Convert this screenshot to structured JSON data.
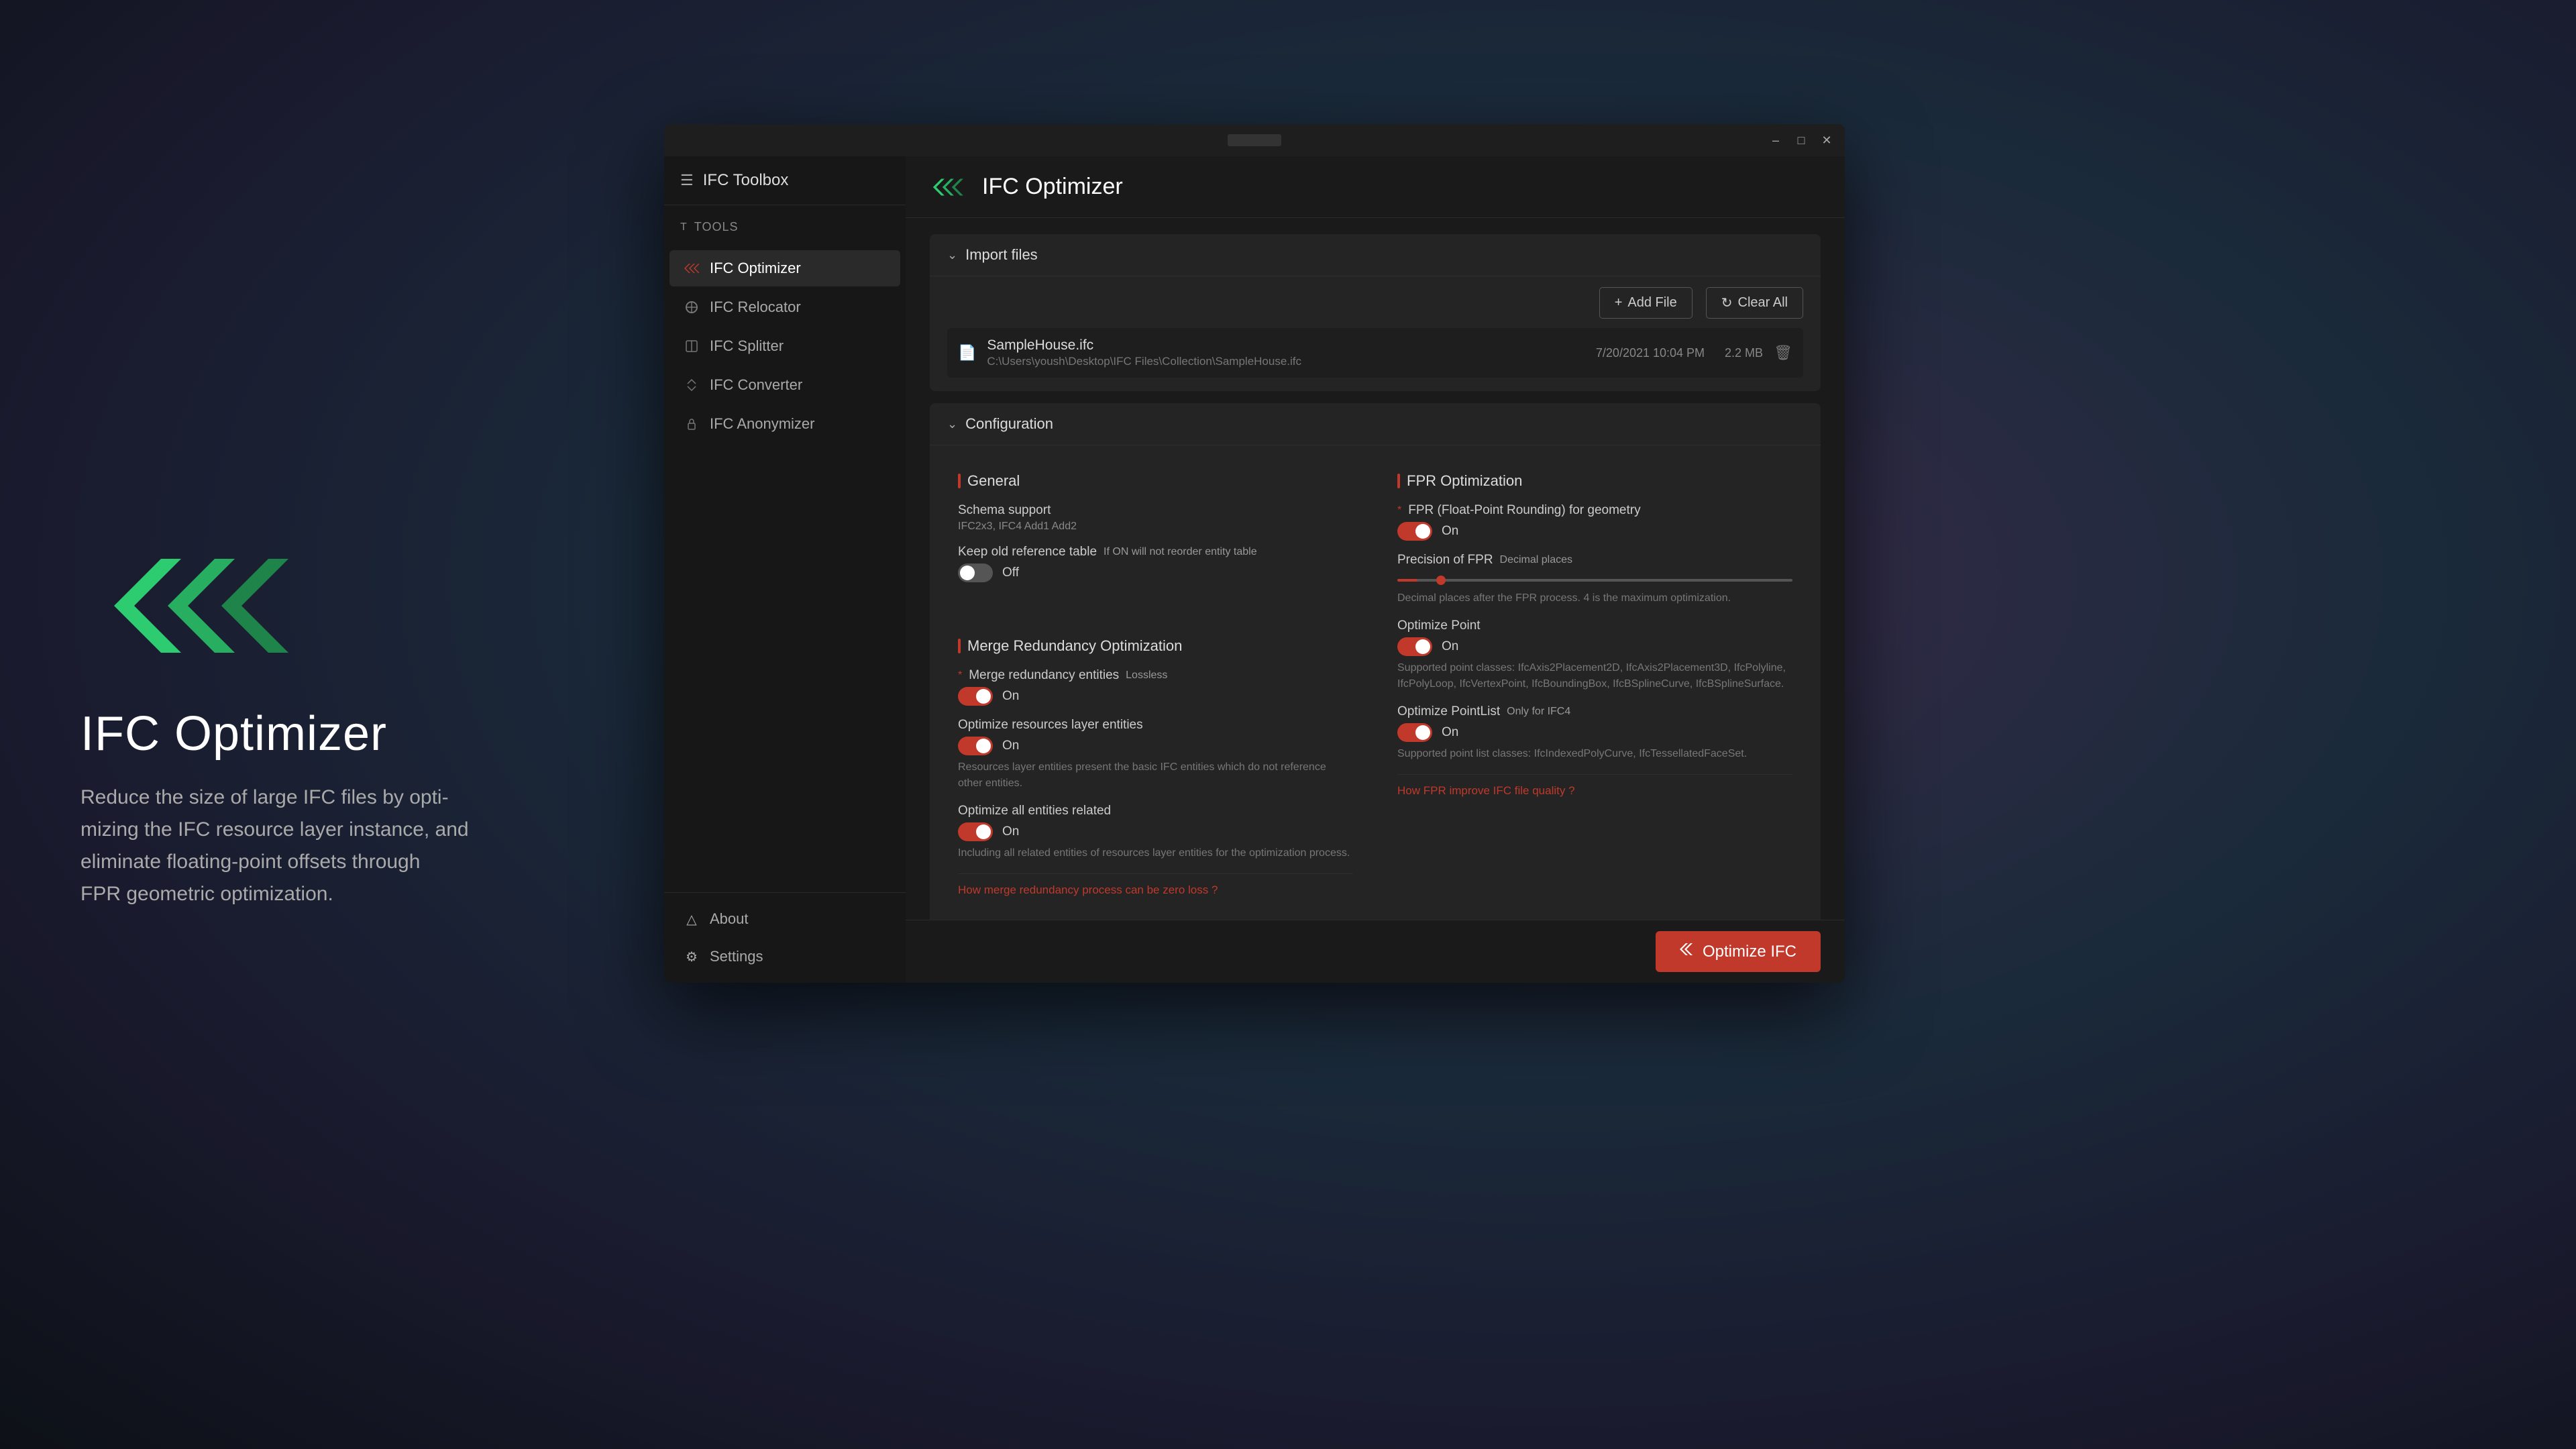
{
  "app": {
    "title": "IFC Optimizer",
    "description": "Reduce the size of large IFC files by opti-\nmizing the IFC resource layer instance, and\neliminate floating-point offsets through\nFPR geometric optimization."
  },
  "window": {
    "title_bar_label": "IFC Optimizer"
  },
  "sidebar": {
    "header": "IFC Toolbox",
    "section_tools": "Tools",
    "items": [
      {
        "id": "ifc-optimizer",
        "label": "IFC Optimizer",
        "active": true
      },
      {
        "id": "ifc-relocator",
        "label": "IFC Relocator",
        "active": false
      },
      {
        "id": "ifc-splitter",
        "label": "IFC Splitter",
        "active": false
      },
      {
        "id": "ifc-converter",
        "label": "IFC Converter",
        "active": false
      },
      {
        "id": "ifc-anonymizer",
        "label": "IFC Anonymizer",
        "active": false
      }
    ],
    "bottom": [
      {
        "id": "about",
        "label": "About"
      },
      {
        "id": "settings",
        "label": "Settings"
      }
    ]
  },
  "main": {
    "header_title": "IFC Optimizer",
    "import_files": {
      "section_title": "Import files",
      "add_file_btn": "Add File",
      "clear_all_btn": "Clear All",
      "file": {
        "name": "SampleHouse.ifc",
        "path": "C:\\Users\\yoush\\Desktop\\IFC Files\\Collection\\SampleHouse.ifc",
        "date": "7/20/2021 10:04 PM",
        "size": "2.2 MB"
      }
    },
    "configuration": {
      "section_title": "Configuration",
      "general": {
        "title": "General",
        "schema_support_label": "Schema support",
        "schema_support_value": "IFC2x3, IFC4 Add1 Add2",
        "keep_old_ref_label": "Keep old reference table",
        "keep_old_ref_hint": "If ON will not reorder entity table",
        "keep_old_ref_state": "off",
        "keep_old_ref_toggle_label": "Off"
      },
      "merge_redundancy": {
        "title": "Merge Redundancy Optimization",
        "merge_entities_label": "Merge redundancy entities",
        "merge_entities_badge": "Lossless",
        "merge_entities_state": "on",
        "merge_entities_toggle_label": "On",
        "optimize_resources_label": "Optimize resources layer entities",
        "optimize_resources_state": "on",
        "optimize_resources_toggle_label": "On",
        "optimize_resources_note": "Resources layer entities present the basic IFC entities which do not\nreference other entities.",
        "optimize_all_label": "Optimize all entities related",
        "optimize_all_state": "on",
        "optimize_all_toggle_label": "On",
        "optimize_all_note": "Including all related entities of resources layer entities for the\noptimization process.",
        "link_text": "How merge redundancy process can be zero loss ?"
      },
      "fpr": {
        "title": "FPR Optimization",
        "fpr_main_label": "FPR (Float-Point Rounding) for geometry",
        "fpr_main_state": "on",
        "fpr_main_toggle_label": "On",
        "precision_label": "Precision of FPR",
        "precision_hint": "Decimal places",
        "precision_note": "Decimal places after the FPR process. 4 is the maximum optimization.",
        "optimize_point_label": "Optimize Point",
        "optimize_point_state": "on",
        "optimize_point_toggle_label": "On",
        "optimize_point_note": "Supported point classes: IfcAxis2Placement2D, IfcAxis2Placement3D,\nIfcPolyline, IfcPolyLoop, IfcVertexPoint, IfcBoundingBox, IfcBSplineCurve,\nIfcBSplineSurface.",
        "optimize_pointlist_label": "Optimize PointList",
        "optimize_pointlist_badge": "Only for IFC4",
        "optimize_pointlist_state": "on",
        "optimize_pointlist_toggle_label": "On",
        "optimize_pointlist_note": "Supported point list classes: IfcIndexedPolyCurve, IfcTessellatedFaceSet.",
        "fpr_link_text": "How FPR improve IFC file quality ?"
      }
    },
    "footer": {
      "optimize_btn": "Optimize IFC"
    }
  }
}
